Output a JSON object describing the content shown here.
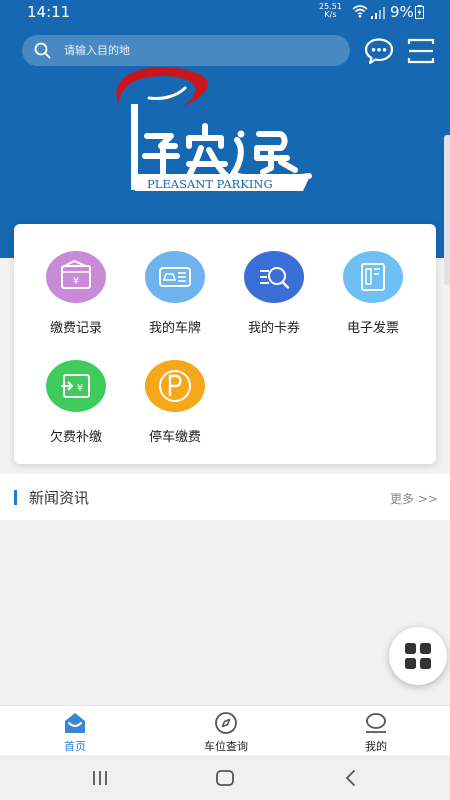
{
  "status_bar": {
    "time": "14:11",
    "speed_value": "25.51",
    "speed_unit": "K/s",
    "battery": "9%"
  },
  "search": {
    "placeholder": "请输入目的地"
  },
  "header": {
    "chat_icon": "chat-bubble-icon",
    "menu_icon": "menu-icon"
  },
  "logo": {
    "brand_cn": "停安逸",
    "brand_en": "PLEASANT PARKING",
    "colors": {
      "red": "#c8161d",
      "white": "#ffffff",
      "blue": "#1568b1"
    }
  },
  "quick_actions": [
    {
      "label": "缴费记录",
      "icon": "wallet-icon",
      "color": "#c98ad8"
    },
    {
      "label": "我的车牌",
      "icon": "license-plate-icon",
      "color": "#6eb2ee"
    },
    {
      "label": "我的卡券",
      "icon": "coupon-search-icon",
      "color": "#3a6fd8"
    },
    {
      "label": "电子发票",
      "icon": "invoice-icon",
      "color": "#6ec0f2"
    },
    {
      "label": "欠费补缴",
      "icon": "payment-due-icon",
      "color": "#3fcc5c"
    },
    {
      "label": "停车缴费",
      "icon": "parking-icon",
      "color": "#f6a71a"
    }
  ],
  "news": {
    "title": "新闻资讯",
    "more": "更多 >>"
  },
  "tabs": [
    {
      "label": "首页",
      "icon": "home-icon",
      "active": true
    },
    {
      "label": "车位查询",
      "icon": "compass-icon",
      "active": false
    },
    {
      "label": "我的",
      "icon": "profile-icon",
      "active": false
    }
  ],
  "colors": {
    "primary": "#1568b1",
    "accent": "#2b85d4",
    "background": "#f2f2f2"
  }
}
